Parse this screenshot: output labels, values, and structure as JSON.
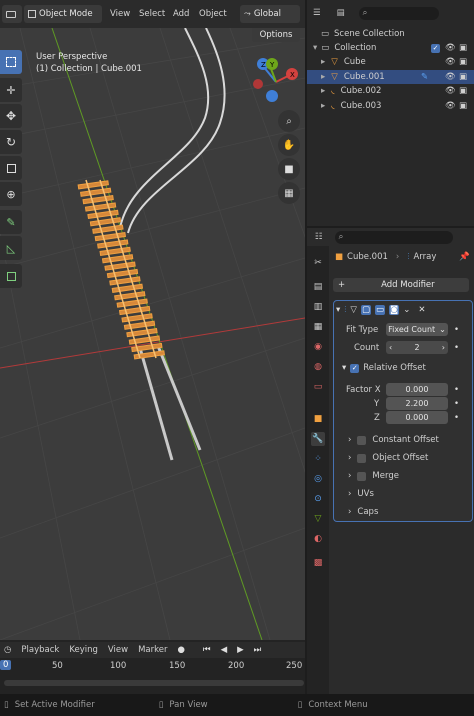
{
  "viewport_header": {
    "mode": "Object Mode",
    "menus": [
      "View",
      "Select",
      "Add",
      "Object"
    ],
    "orientation": "Global",
    "options": "Options"
  },
  "viewport": {
    "perspective": "User Perspective",
    "context": "(1) Collection | Cube.001",
    "gizmo_axes": [
      "X",
      "Y",
      "Z"
    ]
  },
  "outliner": {
    "root": "Scene Collection",
    "collection": "Collection",
    "items": [
      {
        "name": "Cube",
        "selected": false,
        "icon": "mesh-object-icon"
      },
      {
        "name": "Cube.001",
        "selected": true,
        "icon": "mesh-object-icon"
      },
      {
        "name": "Cube.002",
        "selected": false,
        "icon": "curve-object-icon"
      },
      {
        "name": "Cube.003",
        "selected": false,
        "icon": "curve-object-icon"
      }
    ]
  },
  "properties": {
    "breadcrumb_object": "Cube.001",
    "breadcrumb_modifier": "Array",
    "add_modifier": "Add Modifier",
    "fit_type_label": "Fit Type",
    "fit_type_value": "Fixed Count",
    "count_label": "Count",
    "count_value": "2",
    "relative_offset": "Relative Offset",
    "factor_x_label": "Factor X",
    "factor_x": "0.000",
    "y_label": "Y",
    "factor_y": "2.200",
    "z_label": "Z",
    "factor_z": "0.000",
    "sections": [
      "Constant Offset",
      "Object Offset",
      "Merge",
      "UVs",
      "Caps"
    ]
  },
  "timeline": {
    "menus": [
      "Playback",
      "Keying",
      "View",
      "Marker"
    ],
    "ticks": [
      "0",
      "50",
      "100",
      "150",
      "200",
      "250"
    ]
  },
  "status": {
    "left": "Set Active Modifier",
    "middle": "Pan View",
    "right": "Context Menu"
  },
  "colors": {
    "accent": "#4772b3",
    "selected_orange": "#f0a040",
    "x_axis": "#d3423f",
    "y_axis": "#6ea61a",
    "z_axis": "#3f7fd8"
  }
}
